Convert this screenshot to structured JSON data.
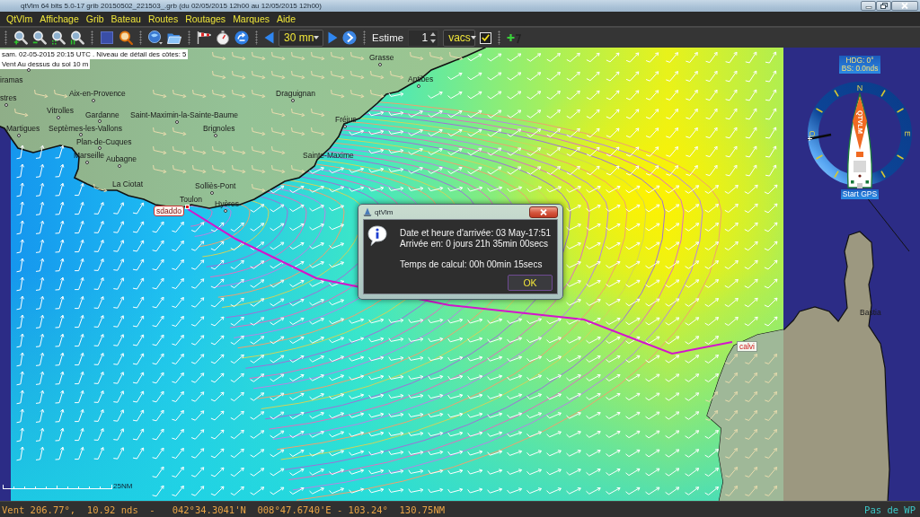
{
  "window": {
    "title": "qtVlm 64 bits 5.0-17 grib 20150502_221503_.grb (du 02/05/2015 12h00 au 12/05/2015 12h00)"
  },
  "menu": [
    "QtVlm",
    "Affichage",
    "Grib",
    "Bateau",
    "Routes",
    "Routages",
    "Marques",
    "Aide"
  ],
  "toolbar": {
    "step": "30 mn",
    "estime": {
      "label": "Estime",
      "value": "1",
      "unit": "vacs",
      "checked": true
    }
  },
  "map": {
    "info": [
      "sam. 02-05-2015 20:15 UTC . Niveau de détail des côtes: 5",
      "Vent Au dessus du sol 10 m"
    ],
    "places": [
      {
        "name": "Grasse",
        "kind": "city"
      },
      {
        "name": "Antibes",
        "kind": "city"
      },
      {
        "name": "iramas",
        "kind": "city"
      },
      {
        "name": "Aix-en-Provence",
        "kind": "city"
      },
      {
        "name": "Draguignan",
        "kind": "city"
      },
      {
        "name": "stres",
        "kind": "city"
      },
      {
        "name": "Vitrolles",
        "kind": "city"
      },
      {
        "name": "Gardanne",
        "kind": "city"
      },
      {
        "name": "Saint-Maximin-la-Sainte-Baume",
        "kind": "city"
      },
      {
        "name": "Fréjus",
        "kind": "city"
      },
      {
        "name": "Martigues",
        "kind": "city"
      },
      {
        "name": "Septèmes-les-Vallons",
        "kind": "city"
      },
      {
        "name": "Brignoles",
        "kind": "city"
      },
      {
        "name": "Plan-de-Cuques",
        "kind": "city"
      },
      {
        "name": "Marseille",
        "kind": "city"
      },
      {
        "name": "Sainte-Maxime",
        "kind": "city"
      },
      {
        "name": "Aubagne",
        "kind": "city"
      },
      {
        "name": "Solliès-Pont",
        "kind": "city"
      },
      {
        "name": "La Ciotat",
        "kind": "city"
      },
      {
        "name": "Toulon",
        "kind": "city"
      },
      {
        "name": "Hyères",
        "kind": "city"
      },
      {
        "name": "sdaddo",
        "kind": "boat"
      },
      {
        "name": "Bastia",
        "kind": "city"
      },
      {
        "name": "calvi",
        "kind": "waypoint"
      }
    ],
    "scale": "25NM"
  },
  "compass": {
    "heading": "HDG: 0°",
    "speed": "BS: 0.0nds",
    "north": "N",
    "east": "E",
    "west": "O",
    "sail": "QTVLM",
    "gps_button": "Start GPS"
  },
  "dialog": {
    "title": "qtVlm",
    "paragraphs": [
      [
        "Date et heure d'arrivée: 03 May-17:51",
        "Arrivée en: 0 jours 21h 35min 00secs"
      ],
      [
        "Temps de calcul: 00h 00min 15secs"
      ]
    ],
    "button": "OK"
  },
  "status_bar": {
    "text": "Vent 206.77°,  10.92 nds  -   042°34.3041'N  008°47.6740'E - 103.24°  130.75NM",
    "waypoint": "Pas de WP"
  }
}
